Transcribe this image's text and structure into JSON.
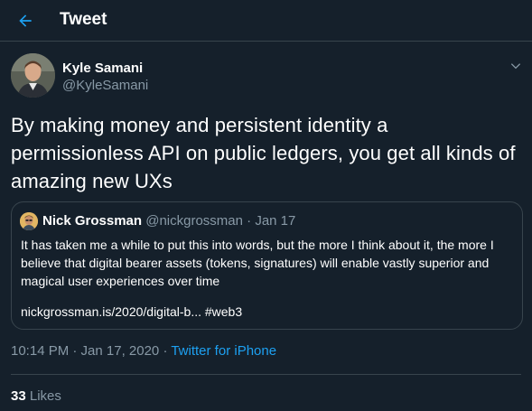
{
  "header": {
    "title": "Tweet",
    "back_icon": "arrow-left-icon",
    "accent_color": "#1da1f2"
  },
  "tweet": {
    "author_name": "Kyle Samani",
    "author_handle": "@KyleSamani",
    "more_icon": "chevron-down-icon",
    "text": "By making money and persistent identity a permissionless API on public ledgers, you get all kinds of amazing new UXs",
    "timestamp": "10:14 PM · Jan 17, 2020",
    "separator": " · ",
    "source": "Twitter for iPhone",
    "likes_count": "33",
    "likes_label": "Likes"
  },
  "quoted_tweet": {
    "author_name": "Nick Grossman",
    "author_handle": "@nickgrossman",
    "date": "· Jan 17",
    "text": "It has taken me a while to put this into words, but the more I think about it, the more I believe that digital bearer assets (tokens, signatures) will enable vastly superior and magical user experiences over time",
    "link_text": "nickgrossman.is/2020/digital-b... #web3"
  },
  "colors": {
    "background": "#15202b",
    "border": "#38444d",
    "secondary_text": "#8899a6",
    "link": "#1da1f2"
  }
}
